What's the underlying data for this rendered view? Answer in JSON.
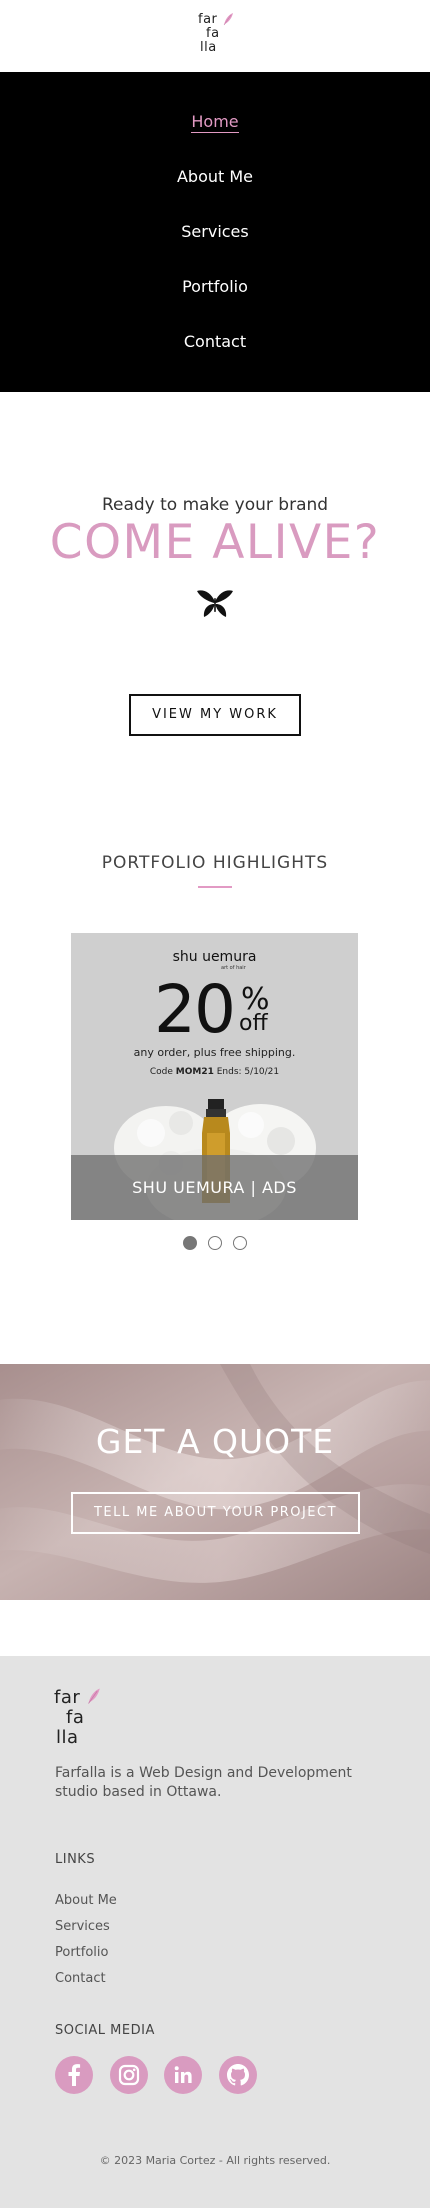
{
  "header": {
    "logo_lines": [
      "far",
      "fa",
      "lla"
    ]
  },
  "nav": {
    "items": [
      {
        "label": "Home",
        "active": true
      },
      {
        "label": "About Me"
      },
      {
        "label": "Services"
      },
      {
        "label": "Portfolio"
      },
      {
        "label": "Contact"
      }
    ]
  },
  "hero": {
    "subtitle": "Ready to make your brand",
    "title": "COME ALIVE?",
    "cta_label": "VIEW MY WORK"
  },
  "portfolio": {
    "title": "PORTFOLIO HIGHLIGHTS",
    "slide": {
      "brand": "shu uemura",
      "brand_sub": "art of hair",
      "discount": "20",
      "percent_sign": "%",
      "off": "off",
      "line1": "any order, plus free shipping.",
      "code_label": "Code",
      "code": "MOM21",
      "ends": "Ends: 5/10/21",
      "caption": "SHU UEMURA | ADS"
    },
    "dots": [
      {
        "active": true
      },
      {
        "active": false
      },
      {
        "active": false
      }
    ]
  },
  "quote": {
    "title": "GET A QUOTE",
    "cta_label": "TELL ME ABOUT YOUR PROJECT"
  },
  "footer": {
    "logo_lines": [
      "far",
      "fa",
      "lla"
    ],
    "description": "Farfalla is a Web Design and Development studio based in Ottawa.",
    "links_heading": "LINKS",
    "links": [
      "About Me",
      "Services",
      "Portfolio",
      "Contact"
    ],
    "social_heading": "SOCIAL MEDIA",
    "social": [
      "facebook-icon",
      "instagram-icon",
      "linkedin-icon",
      "github-icon"
    ],
    "copyright": "© 2023 Maria Cortez - All rights reserved."
  },
  "colors": {
    "accent": "#d99bc0",
    "nav_bg": "#000000",
    "footer_bg": "#e3e3e3"
  }
}
